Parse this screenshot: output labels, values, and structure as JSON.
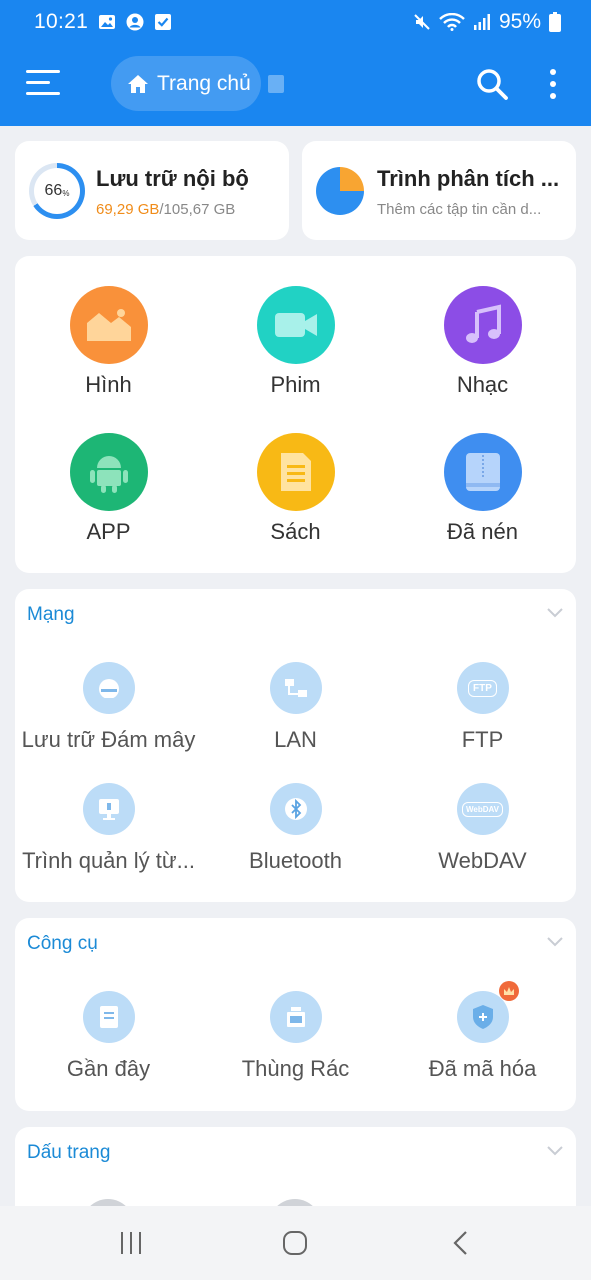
{
  "status_bar": {
    "time": "10:21",
    "battery": "95%"
  },
  "toolbar": {
    "home_label": "Trang chủ"
  },
  "storage": {
    "percent": "66",
    "percent_unit": "%",
    "title": "Lưu trữ nội bộ",
    "used": "69,29 GB",
    "total": "/105,67 GB"
  },
  "analyzer": {
    "title": "Trình phân tích ...",
    "subtitle": "Thêm các tập tin cần d..."
  },
  "categories": [
    {
      "label": "Hình",
      "icon": "image-icon",
      "color": "#f9913a"
    },
    {
      "label": "Phim",
      "icon": "video-icon",
      "color": "#21d2c4"
    },
    {
      "label": "Nhạc",
      "icon": "music-icon",
      "color": "#8c4de6"
    },
    {
      "label": "APP",
      "icon": "android-icon",
      "color": "#1db675"
    },
    {
      "label": "Sách",
      "icon": "book-icon",
      "color": "#f8b915"
    },
    {
      "label": "Đã nén",
      "icon": "archive-icon",
      "color": "#3f8ef0"
    }
  ],
  "network": {
    "header": "Mạng",
    "items": [
      {
        "label": "Lưu trữ Đám mây",
        "icon": "cloud-icon"
      },
      {
        "label": "LAN",
        "icon": "lan-icon"
      },
      {
        "label": "FTP",
        "icon": "ftp-icon",
        "badge": "FTP"
      },
      {
        "label": "Trình quản lý từ...",
        "icon": "remote-manager-icon"
      },
      {
        "label": "Bluetooth",
        "icon": "bluetooth-icon"
      },
      {
        "label": "WebDAV",
        "icon": "webdav-icon",
        "badge": "WebDAV"
      }
    ]
  },
  "tools": {
    "header": "Công cụ",
    "items": [
      {
        "label": "Gần đây",
        "icon": "recent-icon"
      },
      {
        "label": "Thùng Rác",
        "icon": "trash-icon"
      },
      {
        "label": "Đã mã hóa",
        "icon": "encrypted-icon"
      }
    ]
  },
  "bookmarks": {
    "header": "Dấu trang"
  },
  "colors": {
    "primary": "#1a86f0",
    "accent_link": "#1b8ad6",
    "used_storage": "#f08c1a"
  }
}
